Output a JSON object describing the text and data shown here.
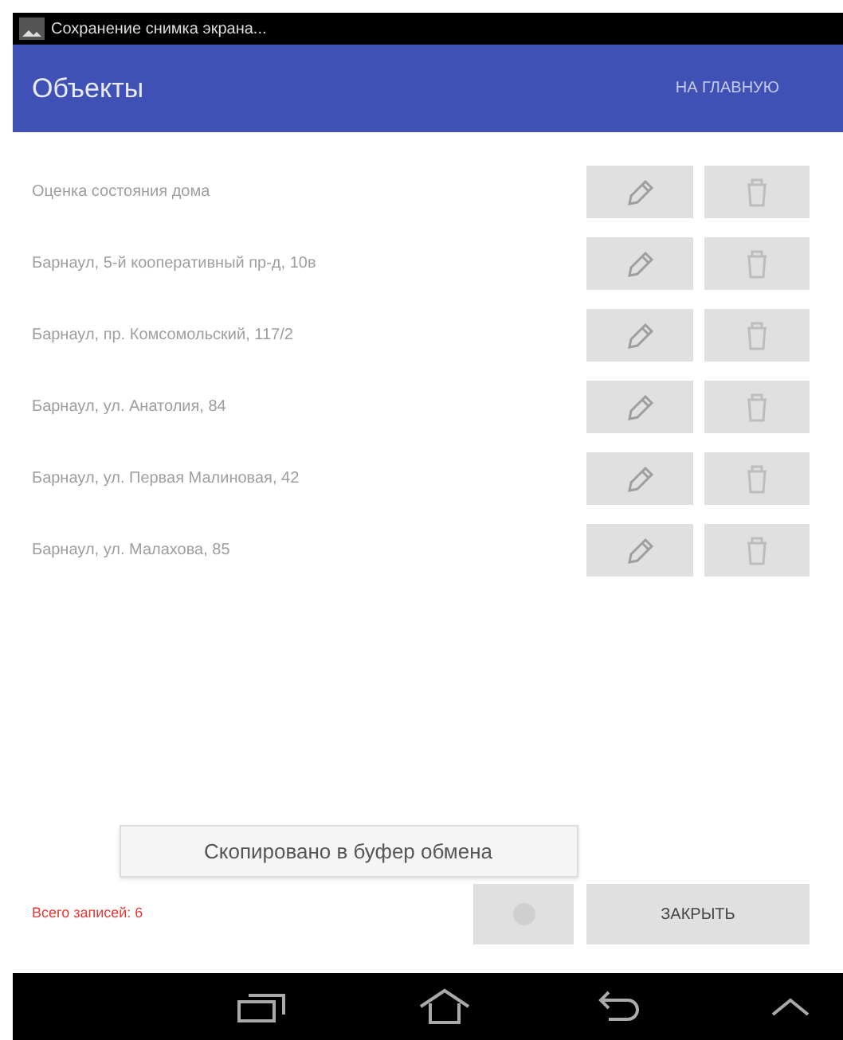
{
  "status_bar": {
    "notification": "Сохранение снимка экрана..."
  },
  "app_bar": {
    "title": "Объекты",
    "action": "НА ГЛАВНУЮ"
  },
  "objects": [
    {
      "name": "Оценка состояния дома"
    },
    {
      "name": "Барнаул, 5-й кооперативный пр-д, 10в"
    },
    {
      "name": "Барнаул, пр. Комсомольский, 117/2"
    },
    {
      "name": "Барнаул, ул. Анатолия, 84"
    },
    {
      "name": "Барнаул, ул. Первая Малиновая, 42"
    },
    {
      "name": "Барнаул, ул. Малахова, 85"
    }
  ],
  "toast": "Скопировано в буфер обмена",
  "footer": {
    "count": "Всего записей: 6",
    "close": "ЗАКРЫТЬ"
  }
}
